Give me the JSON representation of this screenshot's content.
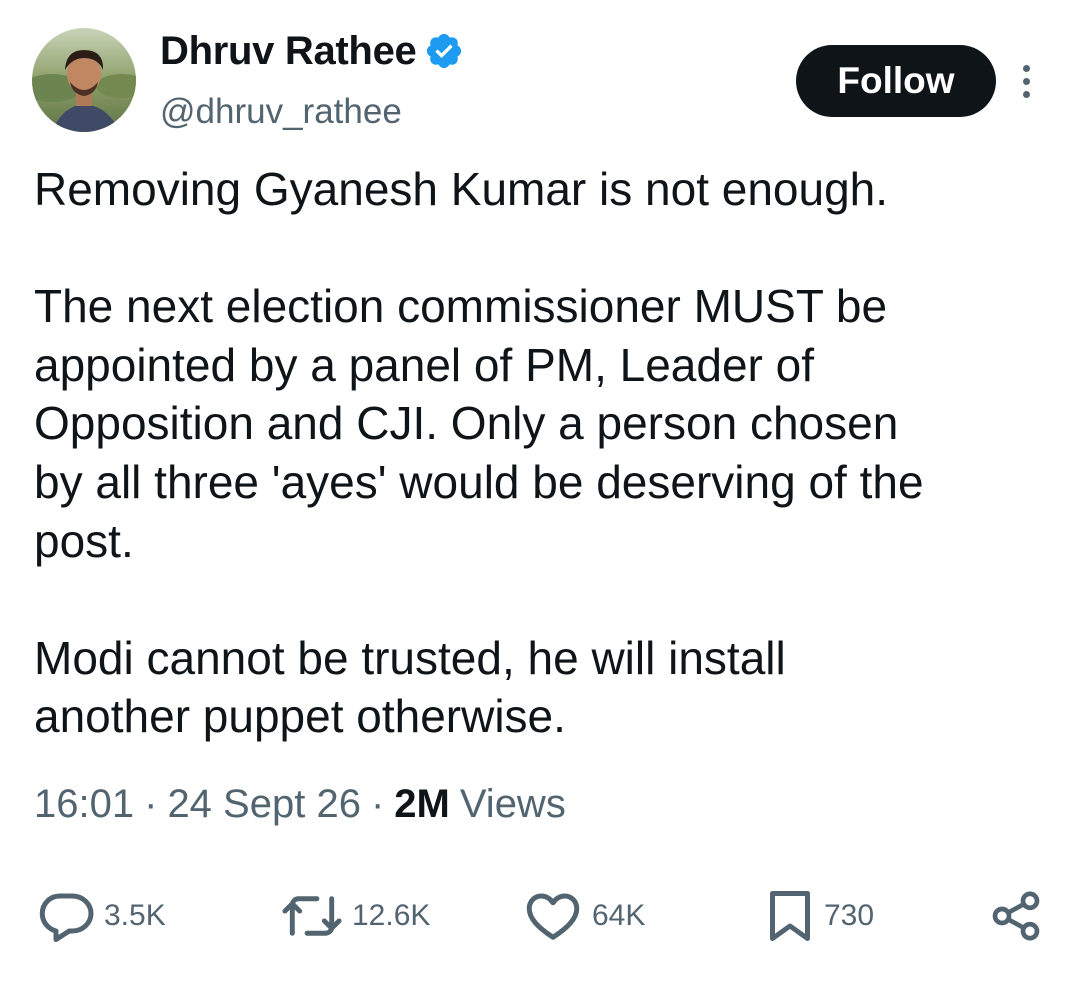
{
  "author": {
    "display_name": "Dhruv Rathee",
    "handle": "@dhruv_rathee",
    "verified_icon": "verified-badge-icon",
    "verified_color": "#1d9bf0"
  },
  "follow_button": {
    "label": "Follow"
  },
  "tweet": {
    "lines": [
      "Removing Gyanesh Kumar is not enough.",
      "",
      "The next election commissioner MUST be",
      "appointed by a panel of PM, Leader of",
      "Opposition and CJI. Only a person chosen",
      "by all three 'ayes' would be deserving of the",
      "post.",
      "",
      "Modi cannot be trusted, he will install",
      "another puppet otherwise."
    ]
  },
  "meta": {
    "time": "16:01",
    "separator": "·",
    "date": "24 Sept 26",
    "views_count": "2M",
    "views_label": "Views"
  },
  "actions": {
    "replies": {
      "icon": "reply-icon",
      "count": "3.5K"
    },
    "reposts": {
      "icon": "repost-icon",
      "count": "12.6K"
    },
    "likes": {
      "icon": "heart-icon",
      "count": "64K"
    },
    "bookmarks": {
      "icon": "bookmark-icon",
      "count": "730"
    },
    "share": {
      "icon": "share-icon"
    }
  },
  "colors": {
    "text_primary": "#0f1419",
    "text_secondary": "#536471",
    "follow_bg": "#0f1419",
    "follow_text": "#ffffff"
  }
}
